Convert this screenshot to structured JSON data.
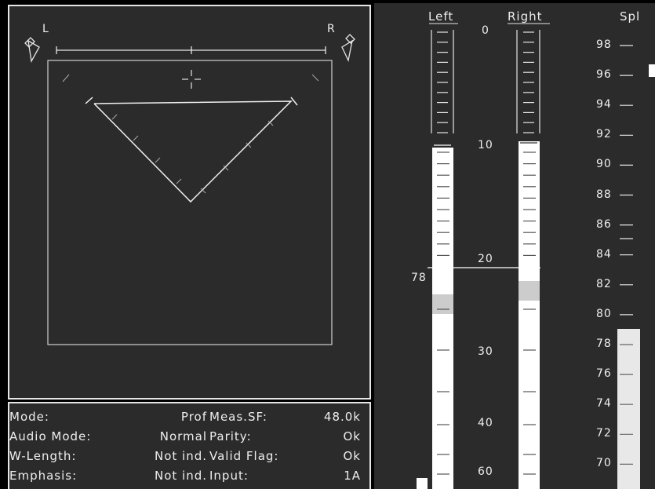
{
  "image_panel": {
    "left_label": "L",
    "right_label": "R"
  },
  "status": {
    "mode_label": "Mode:",
    "mode_value": "Prof",
    "audio_mode_label": "Audio Mode:",
    "audio_mode_value": "Normal",
    "wlength_label": "W-Length:",
    "wlength_value": "Not ind.",
    "emphasis_label": "Emphasis:",
    "emphasis_value": "Not ind.",
    "meas_sf_label": "Meas.SF:",
    "meas_sf_value": "48.0k",
    "parity_label": "Parity:",
    "parity_value": "Ok",
    "valid_flag_label": "Valid Flag:",
    "valid_flag_value": "Ok",
    "input_label": "Input:",
    "input_value": "1A"
  },
  "meters": {
    "left_label": "Left",
    "right_label": "Right",
    "spl_label": "Spl",
    "scale_labels": [
      "0",
      "10",
      "20",
      "30",
      "40",
      "60"
    ],
    "reference_label": "78",
    "spl_scale": [
      "98",
      "96",
      "94",
      "92",
      "90",
      "88",
      "86",
      "84",
      "82",
      "80",
      "78",
      "76",
      "74",
      "72",
      "70"
    ],
    "spl_level": 78
  }
}
